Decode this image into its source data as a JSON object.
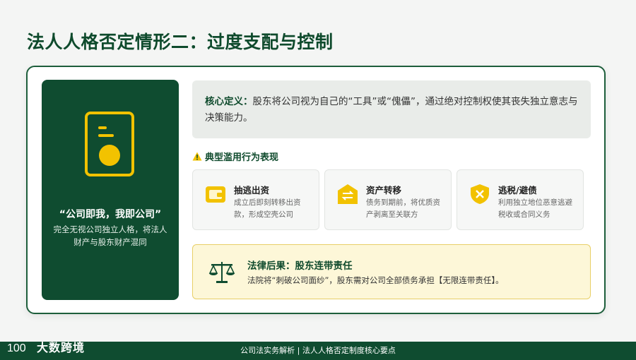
{
  "page": {
    "title": "法人人格否定情形二：过度支配与控制"
  },
  "left_panel": {
    "icon": "document-icon",
    "quote": "“公司即我，我即公司”",
    "description": "完全无视公司独立人格，将法人财产与股东财产混同"
  },
  "definition": {
    "label": "核心定义：",
    "text": "股东将公司视为自己的“工具”或“傀儡”，通过绝对控制权使其丧失独立意志与决策能力。"
  },
  "section": {
    "icon": "warning-icon",
    "heading": "典型滥用行为表现"
  },
  "behaviors": [
    {
      "icon": "wallet-icon",
      "title": "抽逃出资",
      "desc": "成立后即刻转移出资款，形成空壳公司"
    },
    {
      "icon": "transfer-icon",
      "title": "资产转移",
      "desc": "债务到期前，将优质资产剥离至关联方"
    },
    {
      "icon": "shield-x-icon",
      "title": "逃税/避债",
      "desc": "利用独立地位恶意逃避税收或合同义务"
    }
  ],
  "consequence": {
    "icon": "scale-icon",
    "title": "法律后果：股东连带责任",
    "text": "法院将“刺破公司面纱”，股东需对公司全部债务承担【无限连带责任】。"
  },
  "footer": {
    "text": "公司法实务解析 | 法人人格否定制度核心要点",
    "brand": "大数跨境",
    "brand_mark": "100"
  },
  "colors": {
    "primary_green": "#0f4c30",
    "accent_yellow": "#f2c200",
    "result_bg": "#fdf7d8"
  }
}
